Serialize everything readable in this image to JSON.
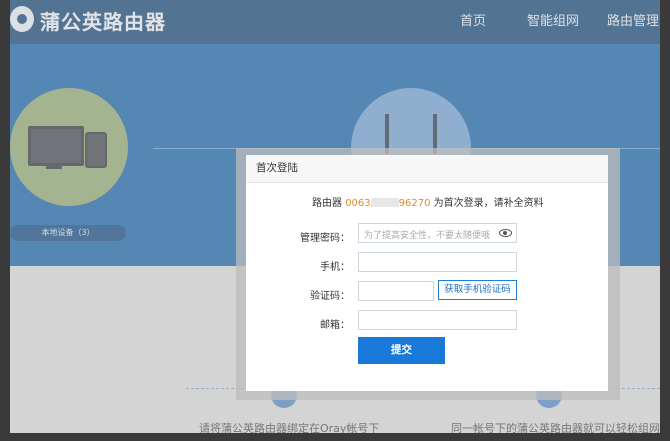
{
  "header": {
    "brand": "蒲公英路由器",
    "nav": [
      "首页",
      "智能组网",
      "路由管理"
    ]
  },
  "background": {
    "device_pill": "本地设备（3）",
    "captions": [
      "请将蒲公英路由器绑定在Oray帐号下",
      "同一帐号下的蒲公英路由器就可以轻松组网"
    ]
  },
  "modal": {
    "title": "首次登陆",
    "info_prefix": "路由器 ",
    "account_start": "0063",
    "account_end": "96270",
    "info_suffix": " 为首次登录，请补全资料",
    "fields": {
      "password_label": "管理密码：",
      "password_placeholder": "为了提高安全性，不要太随便哦",
      "phone_label": "手机：",
      "code_label": "验证码：",
      "email_label": "邮箱："
    },
    "sms_button": "获取手机验证码",
    "submit": "提交"
  },
  "colors": {
    "brand_dark": "#0c3f72",
    "brand_blue": "#0d5fa8",
    "accent_orange": "#e08a2e",
    "button_blue": "#1879d9"
  }
}
